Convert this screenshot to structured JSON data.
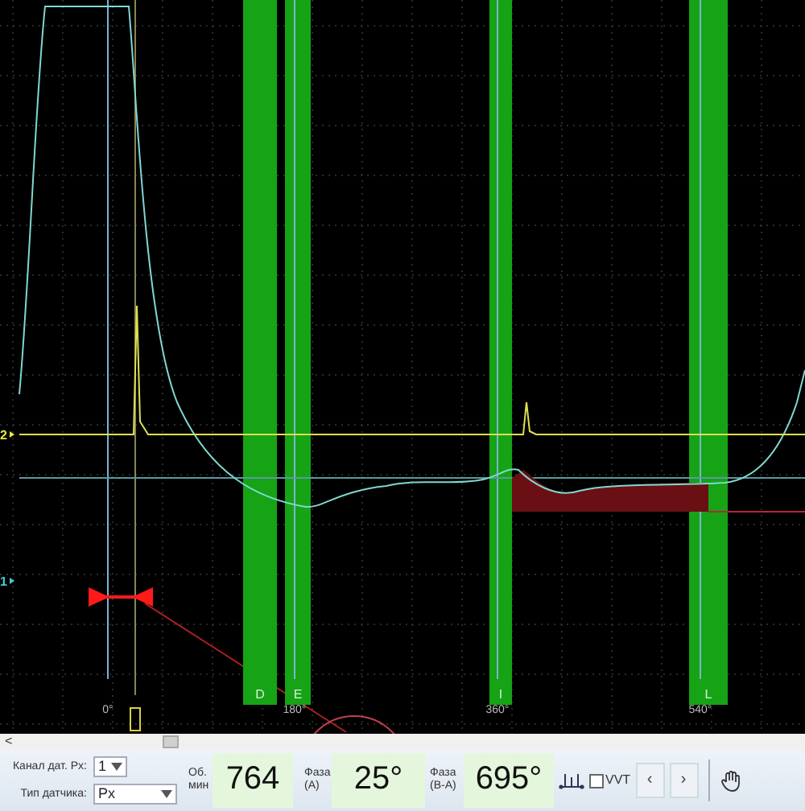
{
  "scope": {
    "channel_markers": [
      {
        "label": "2",
        "color": "#e8e84a"
      },
      {
        "label": "1",
        "color": "#3fc9d8"
      }
    ],
    "angle_marks": [
      "0°",
      "180°",
      "360°",
      "540°"
    ],
    "bands": [
      {
        "label": "D"
      },
      {
        "label": "E"
      },
      {
        "label": "I"
      },
      {
        "label": "L"
      }
    ]
  },
  "scrollbar": {
    "left_arrow": "<"
  },
  "controls": {
    "channel_label": "Канал дат. Рх:",
    "channel_value": "1",
    "sensor_label": "Тип датчика:",
    "sensor_value": "Рх",
    "rpm_label": "Об. мин",
    "rpm_value": "764",
    "phase_a_label": "Фаза (А)",
    "phase_a_value": "25°",
    "phase_ba_label": "Фаза (В-А)",
    "phase_ba_value": "695°",
    "vvt": {
      "label": "VVT",
      "checked": false
    },
    "prev": "‹",
    "next": "›"
  }
}
